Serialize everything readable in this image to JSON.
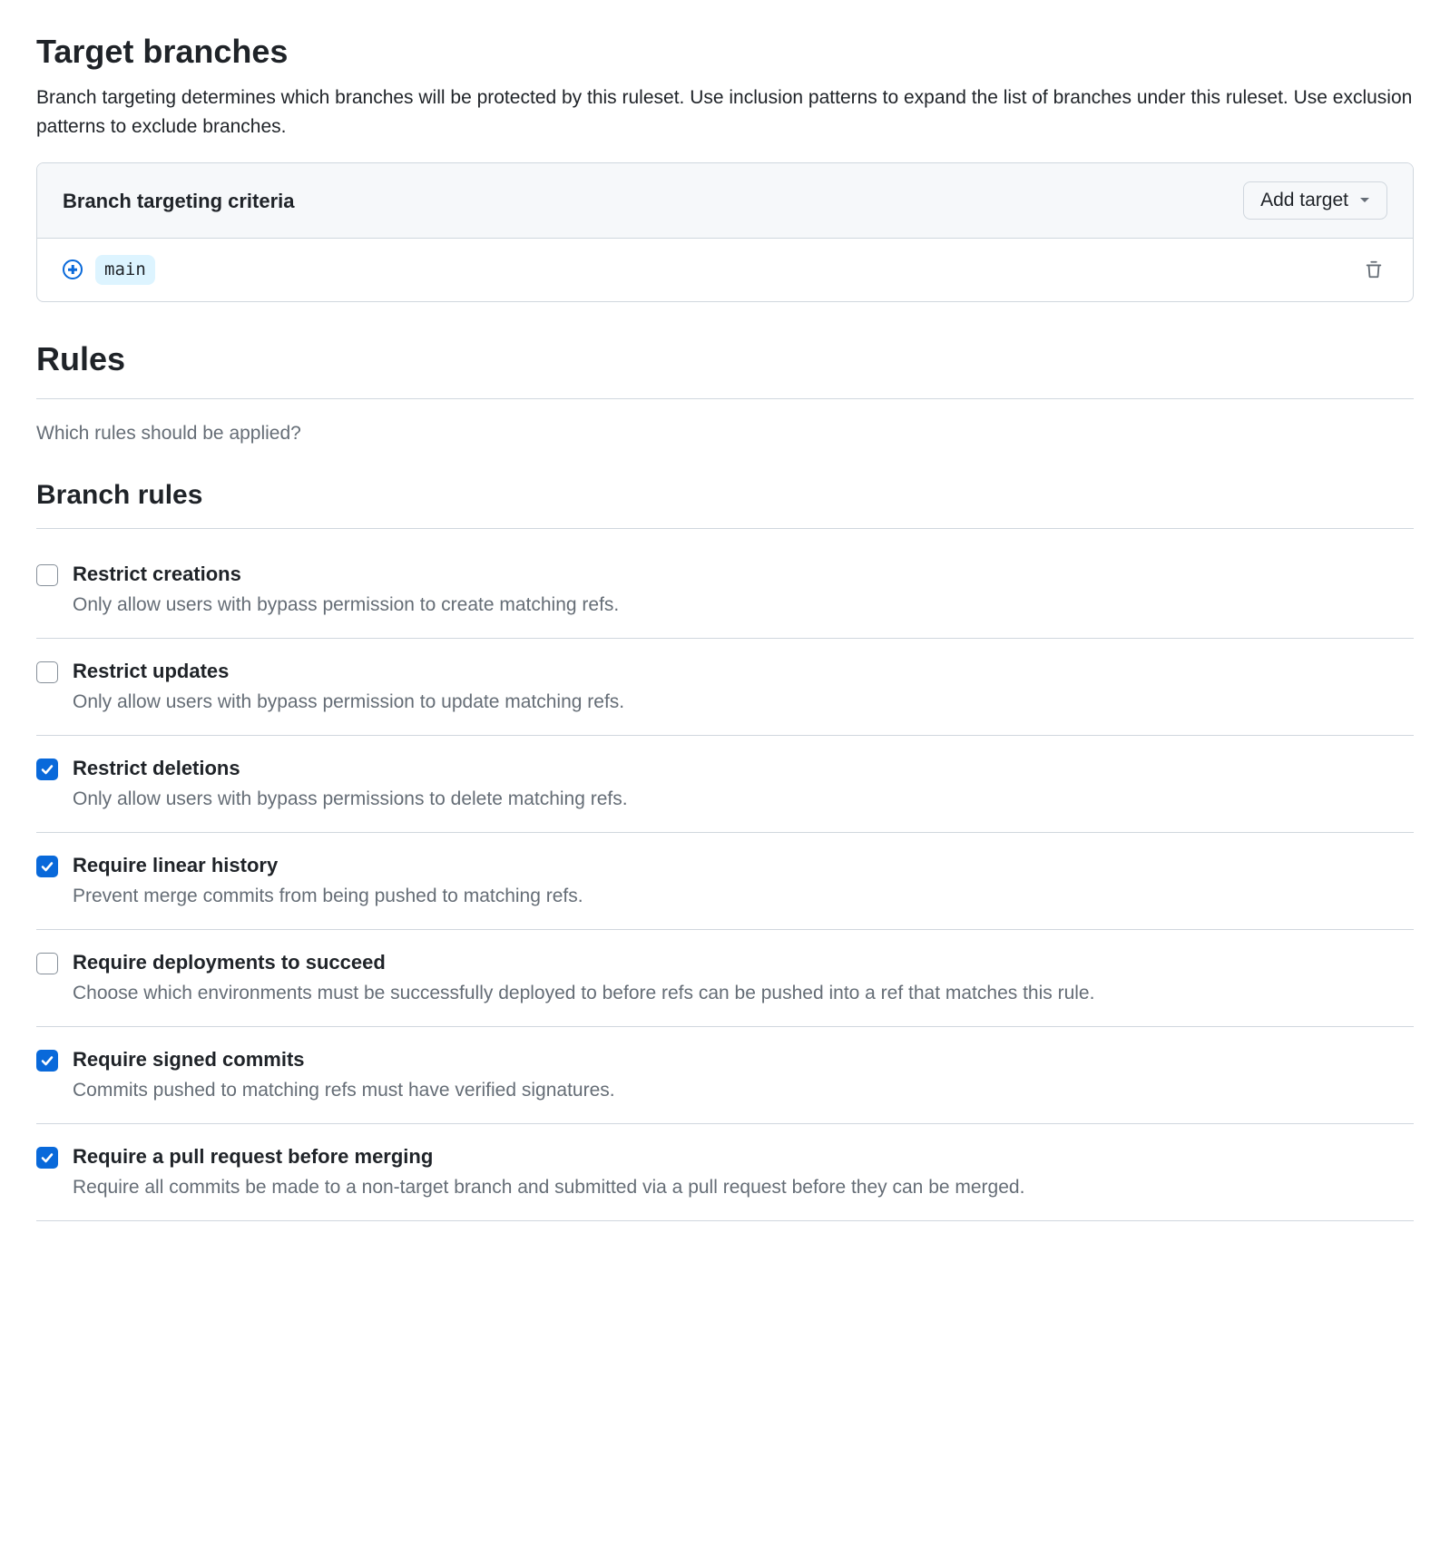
{
  "target_branches": {
    "heading": "Target branches",
    "description": "Branch targeting determines which branches will be protected by this ruleset. Use inclusion patterns to expand the list of branches under this ruleset. Use exclusion patterns to exclude branches.",
    "criteria_title": "Branch targeting criteria",
    "add_target_label": "Add target",
    "entries": [
      {
        "name": "main"
      }
    ]
  },
  "rules": {
    "heading": "Rules",
    "prompt": "Which rules should be applied?",
    "branch_rules_heading": "Branch rules",
    "items": [
      {
        "title": "Restrict creations",
        "description": "Only allow users with bypass permission to create matching refs.",
        "checked": false
      },
      {
        "title": "Restrict updates",
        "description": "Only allow users with bypass permission to update matching refs.",
        "checked": false
      },
      {
        "title": "Restrict deletions",
        "description": "Only allow users with bypass permissions to delete matching refs.",
        "checked": true
      },
      {
        "title": "Require linear history",
        "description": "Prevent merge commits from being pushed to matching refs.",
        "checked": true
      },
      {
        "title": "Require deployments to succeed",
        "description": "Choose which environments must be successfully deployed to before refs can be pushed into a ref that matches this rule.",
        "checked": false
      },
      {
        "title": "Require signed commits",
        "description": "Commits pushed to matching refs must have verified signatures.",
        "checked": true
      },
      {
        "title": "Require a pull request before merging",
        "description": "Require all commits be made to a non-target branch and submitted via a pull request before they can be merged.",
        "checked": true
      }
    ]
  }
}
